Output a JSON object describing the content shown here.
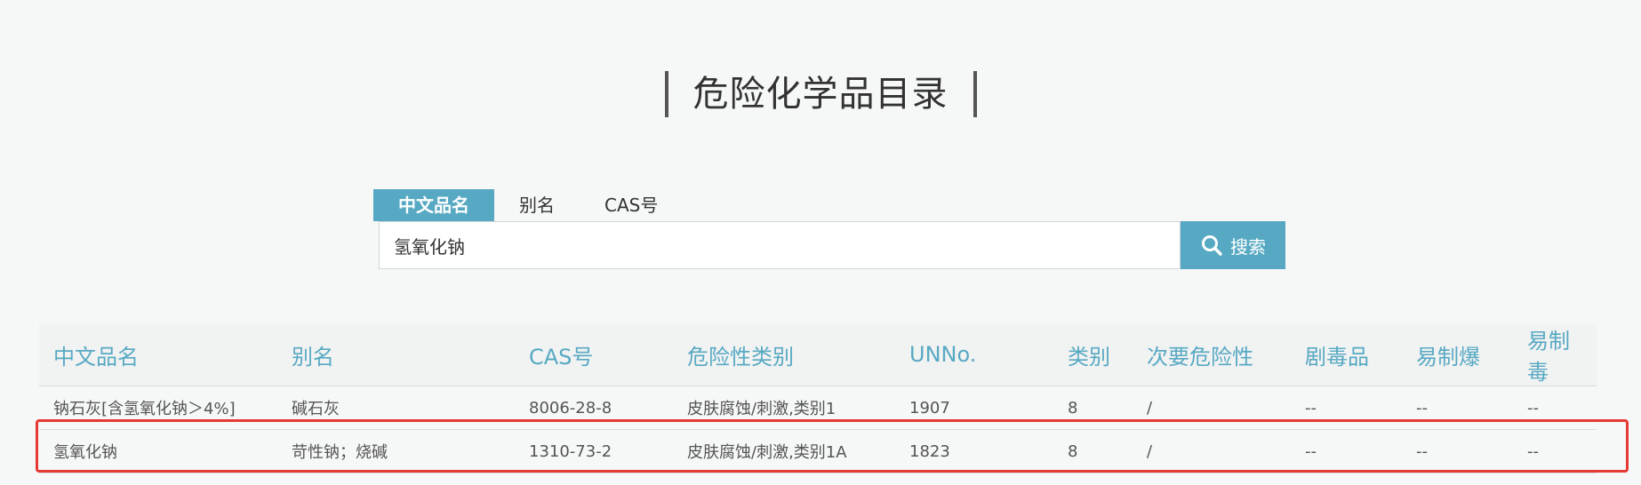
{
  "page": {
    "title": "危险化学品目录"
  },
  "search": {
    "tabs": [
      {
        "label": "中文品名",
        "active": true
      },
      {
        "label": "别名",
        "active": false
      },
      {
        "label": "CAS号",
        "active": false
      }
    ],
    "value": "氢氧化钠",
    "button_label": "搜索",
    "icon": "search-icon"
  },
  "table": {
    "headers": [
      "中文品名",
      "别名",
      "CAS号",
      "危险性类别",
      "UNNo.",
      "类别",
      "次要危险性",
      "剧毒品",
      "易制爆",
      "易制毒"
    ],
    "rows": [
      [
        "钠石灰[含氢氧化钠＞4%]",
        "碱石灰",
        "8006-28-8",
        "皮肤腐蚀/刺激,类别1",
        "1907",
        "8",
        "/",
        "--",
        "--",
        "--"
      ],
      [
        "氢氧化钠",
        "苛性钠；烧碱",
        "1310-73-2",
        "皮肤腐蚀/刺激,类别1A",
        "1823",
        "8",
        "/",
        "--",
        "--",
        "--"
      ]
    ],
    "highlighted_row": 1
  },
  "colors": {
    "accent": "#57a9c3",
    "highlight": "#e53935",
    "background": "#f6f7f7"
  }
}
